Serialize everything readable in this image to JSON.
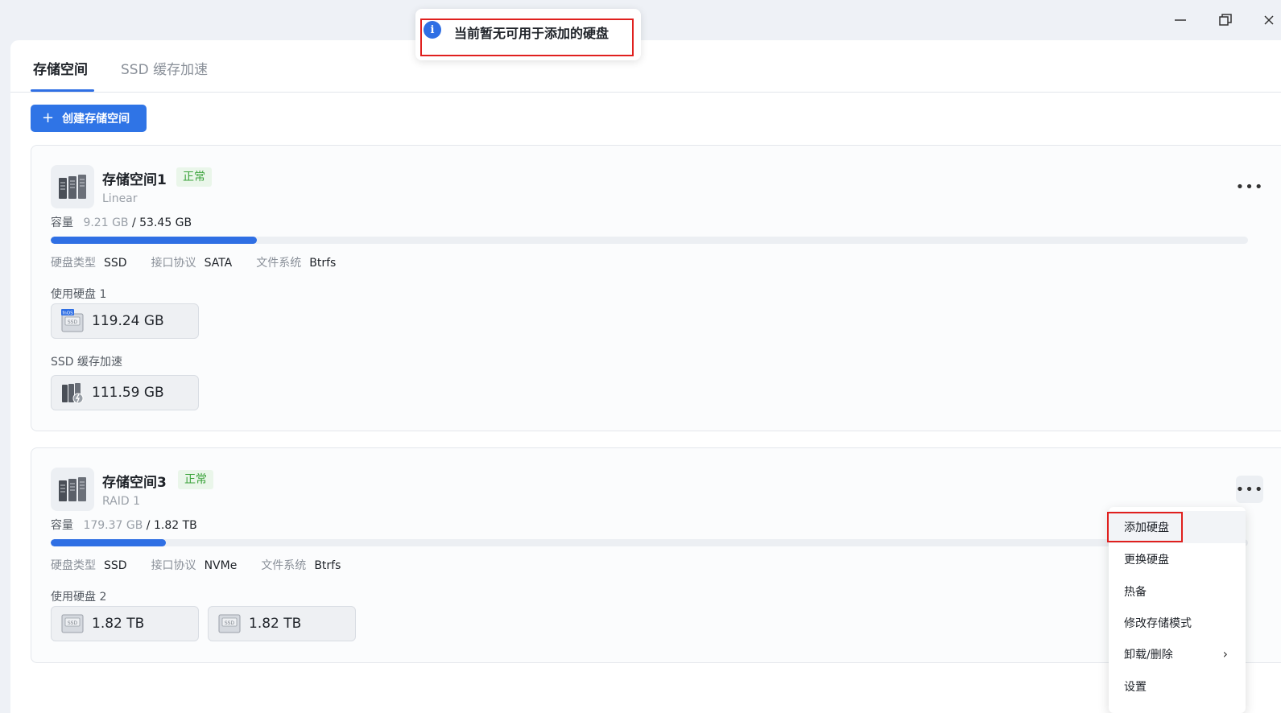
{
  "window": {
    "minimize_icon": "minimize-icon",
    "restore_icon": "restore-icon",
    "close_icon": "close-icon"
  },
  "tabs": [
    {
      "label": "存储空间",
      "active": true
    },
    {
      "label": "SSD 缓存加速",
      "active": false
    }
  ],
  "toolbar": {
    "create_label": "创建存储空间",
    "create_icon": "plus-icon"
  },
  "toast": {
    "text": "当前暂无可用于添加的硬盘",
    "icon": "info-icon"
  },
  "pools": [
    {
      "title": "存储空间1",
      "status": "正常",
      "mode": "Linear",
      "capacity_label": "容量",
      "used": "9.21 GB",
      "total": "/ 53.45 GB",
      "usage_fraction": 0.172,
      "props": [
        {
          "k": "硬盘类型",
          "v": "SSD"
        },
        {
          "k": "接口协议",
          "v": "SATA"
        },
        {
          "k": "文件系统",
          "v": "Btrfs"
        }
      ],
      "disks_label": "使用硬盘 1",
      "disks": [
        "119.24 GB"
      ],
      "cache_label": "SSD 缓存加速",
      "cache": [
        "111.59 GB"
      ]
    },
    {
      "title": "存储空间3",
      "status": "正常",
      "mode": "RAID 1",
      "capacity_label": "容量",
      "used": "179.37 GB",
      "total": "/ 1.82 TB",
      "usage_fraction": 0.096,
      "props": [
        {
          "k": "硬盘类型",
          "v": "SSD"
        },
        {
          "k": "接口协议",
          "v": "NVMe"
        },
        {
          "k": "文件系统",
          "v": "Btrfs"
        }
      ],
      "disks_label": "使用硬盘 2",
      "disks": [
        "1.82 TB",
        "1.82 TB"
      ]
    }
  ],
  "context_menu": {
    "items": [
      "添加硬盘",
      "更换硬盘",
      "热备",
      "修改存储模式",
      "卸载/删除",
      "设置"
    ]
  },
  "colors": {
    "accent": "#2f6fe4",
    "status_ok": "#3aa33a",
    "highlight": "#e0201e"
  }
}
